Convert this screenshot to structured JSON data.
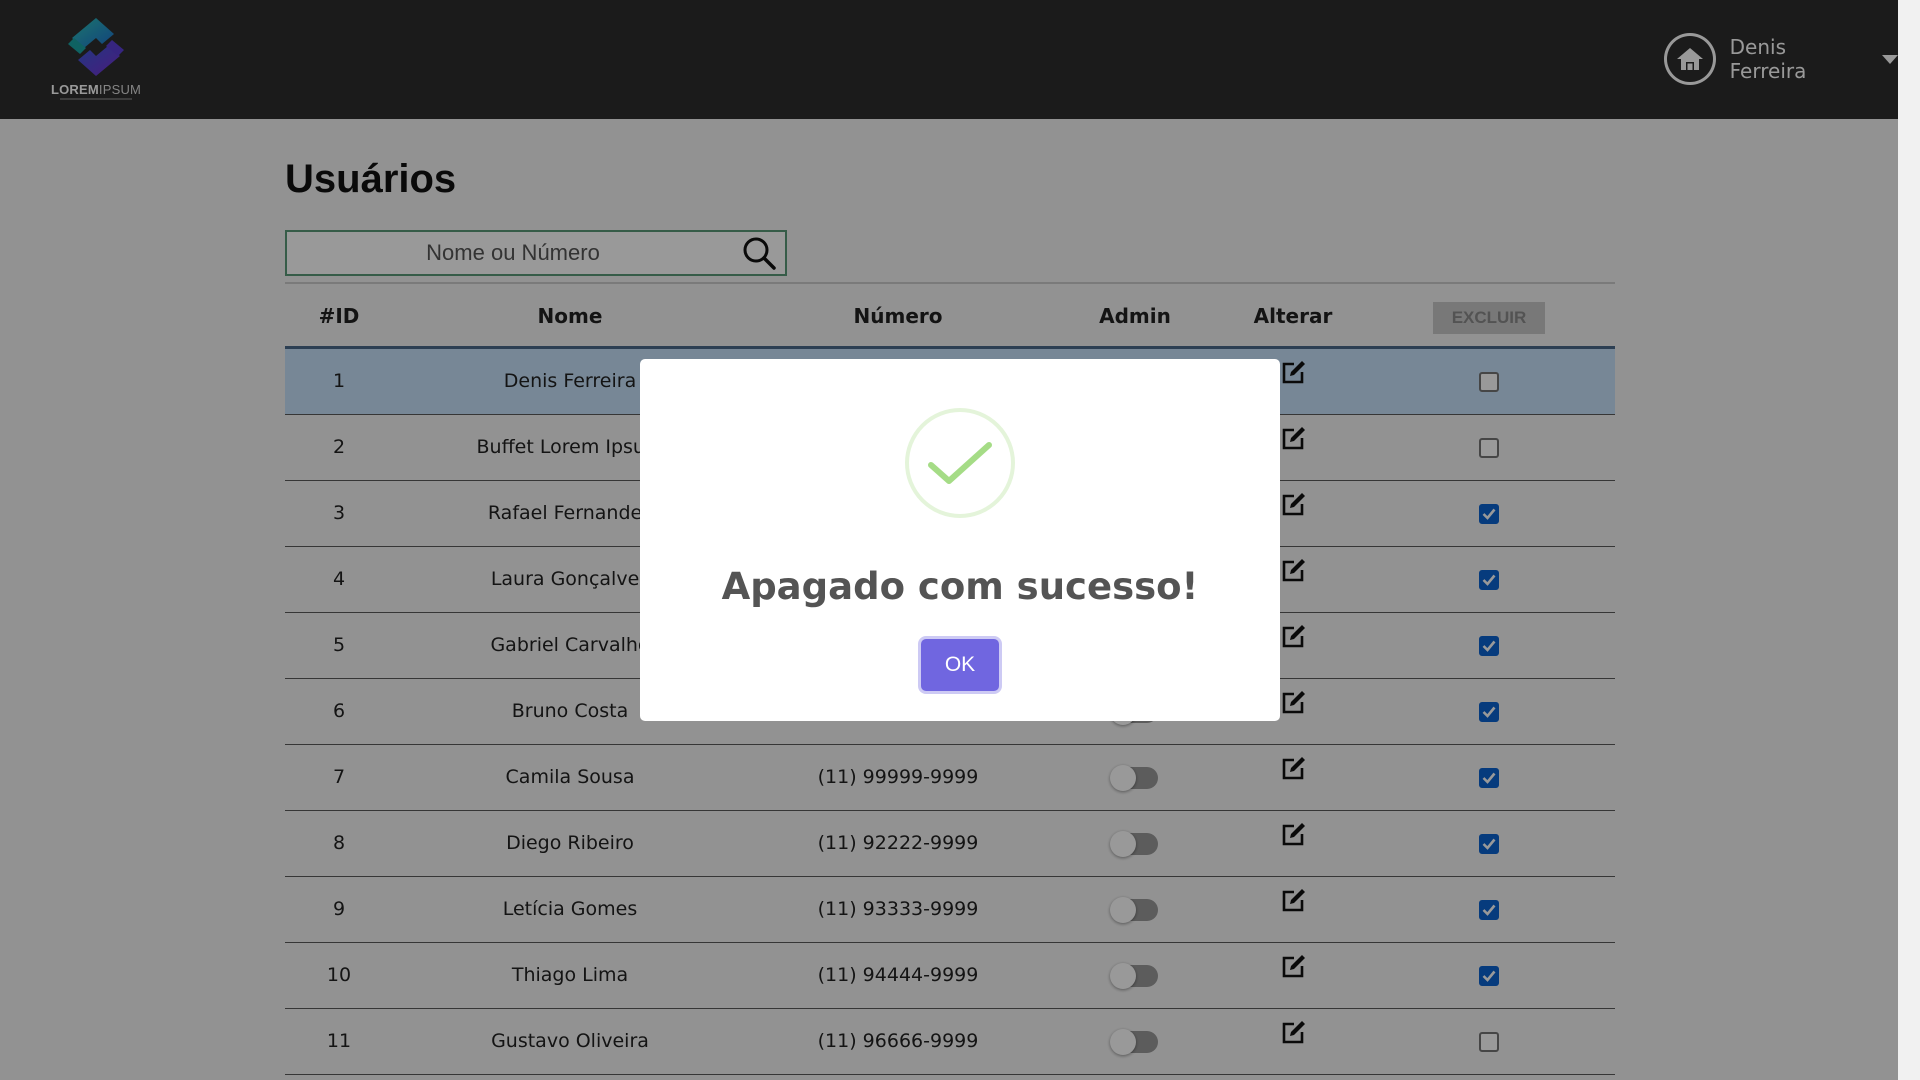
{
  "header": {
    "logo_text_bold": "LOREM",
    "logo_text_light": "IPSUM",
    "user_name": "Denis Ferreira"
  },
  "page": {
    "title": "Usuários",
    "search_placeholder": "Nome ou Número"
  },
  "table": {
    "headers": {
      "id": "#ID",
      "nome": "Nome",
      "numero": "Número",
      "admin": "Admin",
      "alterar": "Alterar",
      "excluir": "EXCLUIR"
    },
    "rows": [
      {
        "id": "1",
        "nome": "Denis Ferreira",
        "numero": "",
        "admin": false,
        "checked": false,
        "selected": true
      },
      {
        "id": "2",
        "nome": "Buffet Lorem Ipsum",
        "numero": "",
        "admin": false,
        "checked": false,
        "selected": false
      },
      {
        "id": "3",
        "nome": "Rafael Fernandes",
        "numero": "",
        "admin": false,
        "checked": true,
        "selected": false
      },
      {
        "id": "4",
        "nome": "Laura Gonçalves",
        "numero": "",
        "admin": false,
        "checked": true,
        "selected": false
      },
      {
        "id": "5",
        "nome": "Gabriel Carvalho",
        "numero": "",
        "admin": false,
        "checked": true,
        "selected": false
      },
      {
        "id": "6",
        "nome": "Bruno Costa",
        "numero": "",
        "admin": false,
        "checked": true,
        "selected": false
      },
      {
        "id": "7",
        "nome": "Camila Sousa",
        "numero": "(11) 99999-9999",
        "admin": false,
        "checked": true,
        "selected": false
      },
      {
        "id": "8",
        "nome": "Diego Ribeiro",
        "numero": "(11) 92222-9999",
        "admin": false,
        "checked": true,
        "selected": false
      },
      {
        "id": "9",
        "nome": "Letícia Gomes",
        "numero": "(11) 93333-9999",
        "admin": false,
        "checked": true,
        "selected": false
      },
      {
        "id": "10",
        "nome": "Thiago Lima",
        "numero": "(11) 94444-9999",
        "admin": false,
        "checked": true,
        "selected": false
      },
      {
        "id": "11",
        "nome": "Gustavo Oliveira",
        "numero": "(11) 96666-9999",
        "admin": false,
        "checked": false,
        "selected": false
      }
    ]
  },
  "modal": {
    "icon": "success-check-icon",
    "title": "Apagado com sucesso!",
    "ok_label": "OK"
  },
  "colors": {
    "header_bg": "#2e2e2e",
    "selected_row": "#c6e2fb",
    "checkbox_checked": "#0b63d0",
    "ok_button": "#7066e0",
    "success_check": "#a5dc86"
  }
}
